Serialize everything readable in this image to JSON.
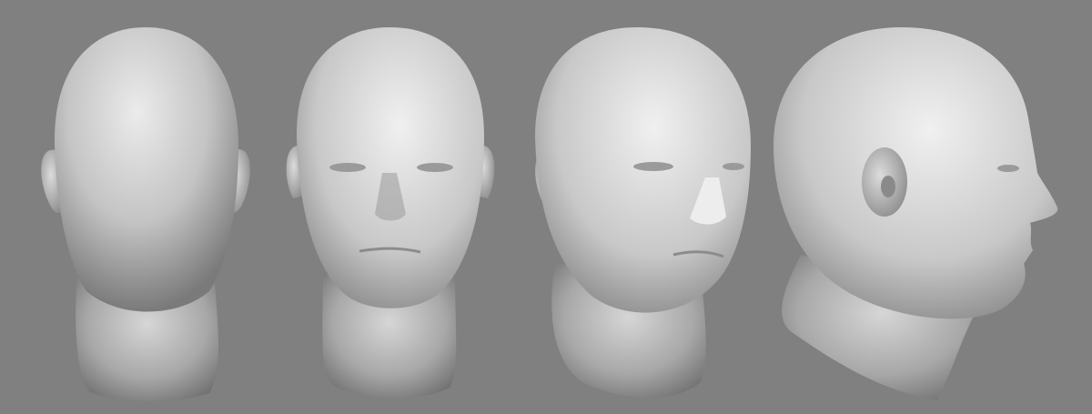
{
  "scene": {
    "background_color": "#808080",
    "skin_light": "#e6e6e6",
    "skin_mid": "#b4b4b4",
    "skin_dark": "#6e6e6e",
    "views": [
      {
        "name": "back-view"
      },
      {
        "name": "front-view"
      },
      {
        "name": "three-quarter-view"
      },
      {
        "name": "profile-view"
      }
    ]
  }
}
